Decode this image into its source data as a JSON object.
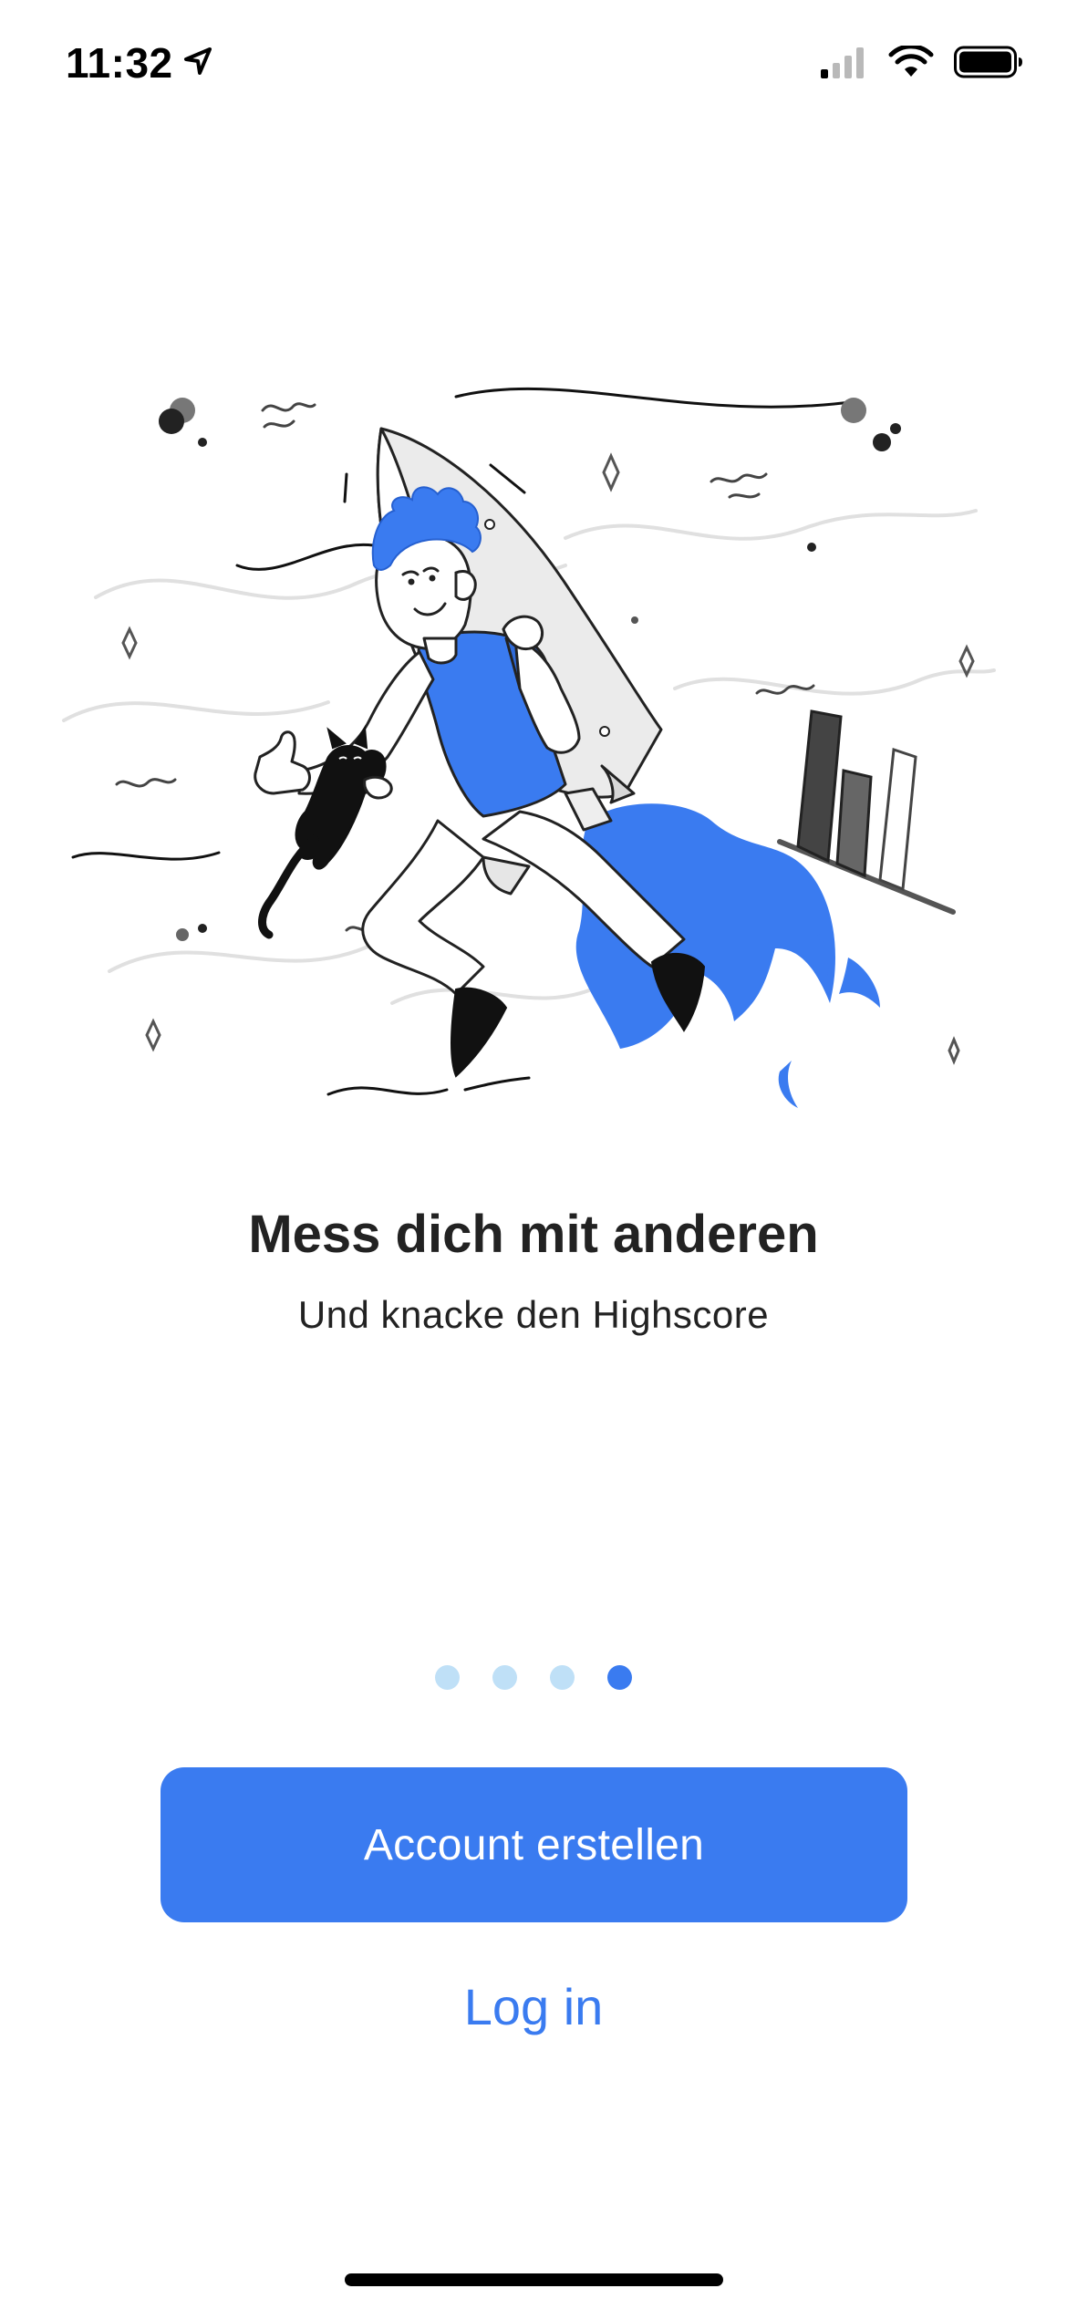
{
  "status_bar": {
    "time": "11:32",
    "icons": [
      "location-arrow-icon",
      "cellular-signal-icon",
      "wifi-icon",
      "battery-icon"
    ]
  },
  "illustration": {
    "icon": "rocket-person-with-cat-illustration"
  },
  "onboarding": {
    "title": "Mess dich mit anderen",
    "subtitle": "Und knacke den Highscore",
    "pages_total": 4,
    "active_page": 4
  },
  "actions": {
    "create_account_label": "Account erstellen",
    "login_label": "Log in"
  },
  "colors": {
    "accent": "#3a7bf0",
    "dot_inactive": "#bfe0f7",
    "text": "#222222"
  }
}
